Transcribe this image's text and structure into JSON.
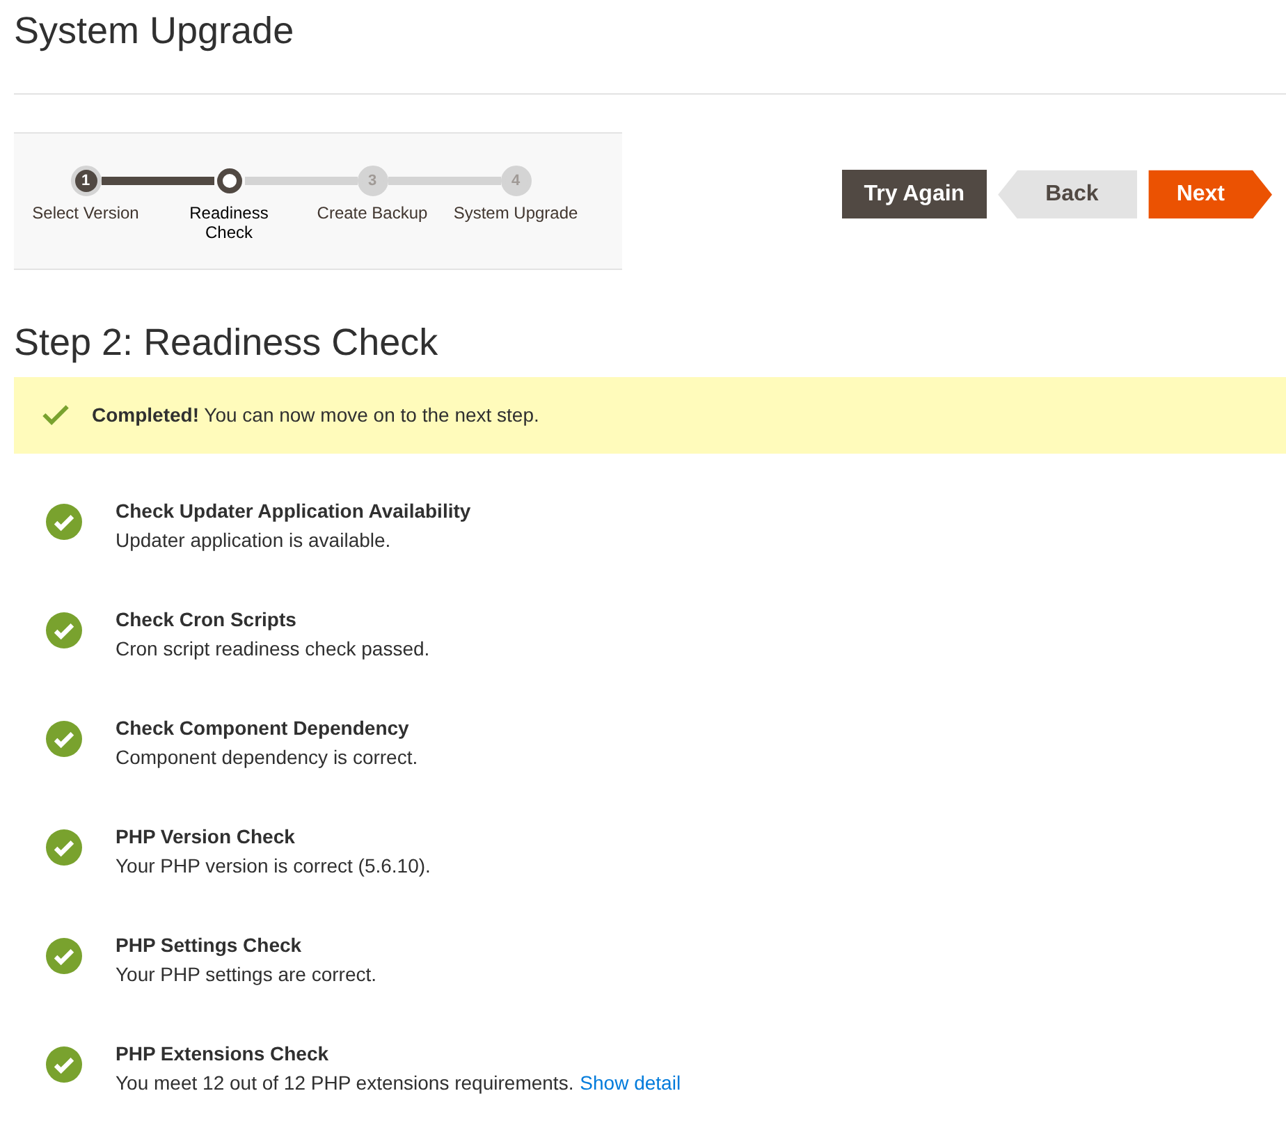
{
  "page_title": "System Upgrade",
  "steps": [
    {
      "number": "1",
      "label": "Select Version",
      "completed": true,
      "selected": false
    },
    {
      "label": "Readiness Check",
      "completed": false,
      "selected": true
    },
    {
      "number": "3",
      "label": "Create Backup",
      "completed": false,
      "selected": false
    },
    {
      "number": "4",
      "label": "System Upgrade",
      "completed": false,
      "selected": false
    }
  ],
  "buttons": [
    {
      "label": "Try Again",
      "kind": "secondary"
    },
    {
      "label": "Back",
      "kind": "back"
    },
    {
      "label": "Next",
      "kind": "next"
    }
  ],
  "step_heading": "Step 2: Readiness Check",
  "alert": {
    "text": "**Completed!** You can now move on to the next step.",
    "success": true
  },
  "checks": [
    {
      "title": "Check Updater Application Availability",
      "message": "Updater application is available.",
      "passed": true
    },
    {
      "title": "Check Cron Scripts",
      "message": "Cron script readiness check passed.",
      "passed": true
    },
    {
      "title": "Check Component Dependency",
      "message": "Component dependency is correct.",
      "passed": true
    },
    {
      "title": "PHP Version Check",
      "message": "Your PHP version is correct (5.6.10).",
      "passed": true
    },
    {
      "title": "PHP Settings Check",
      "message": "Your PHP settings are correct.",
      "passed": true
    },
    {
      "title": "PHP Extensions Check",
      "message": "You meet 12 out of 12 PHP extensions requirements.",
      "link": "Show detail",
      "passed": true
    }
  ]
}
